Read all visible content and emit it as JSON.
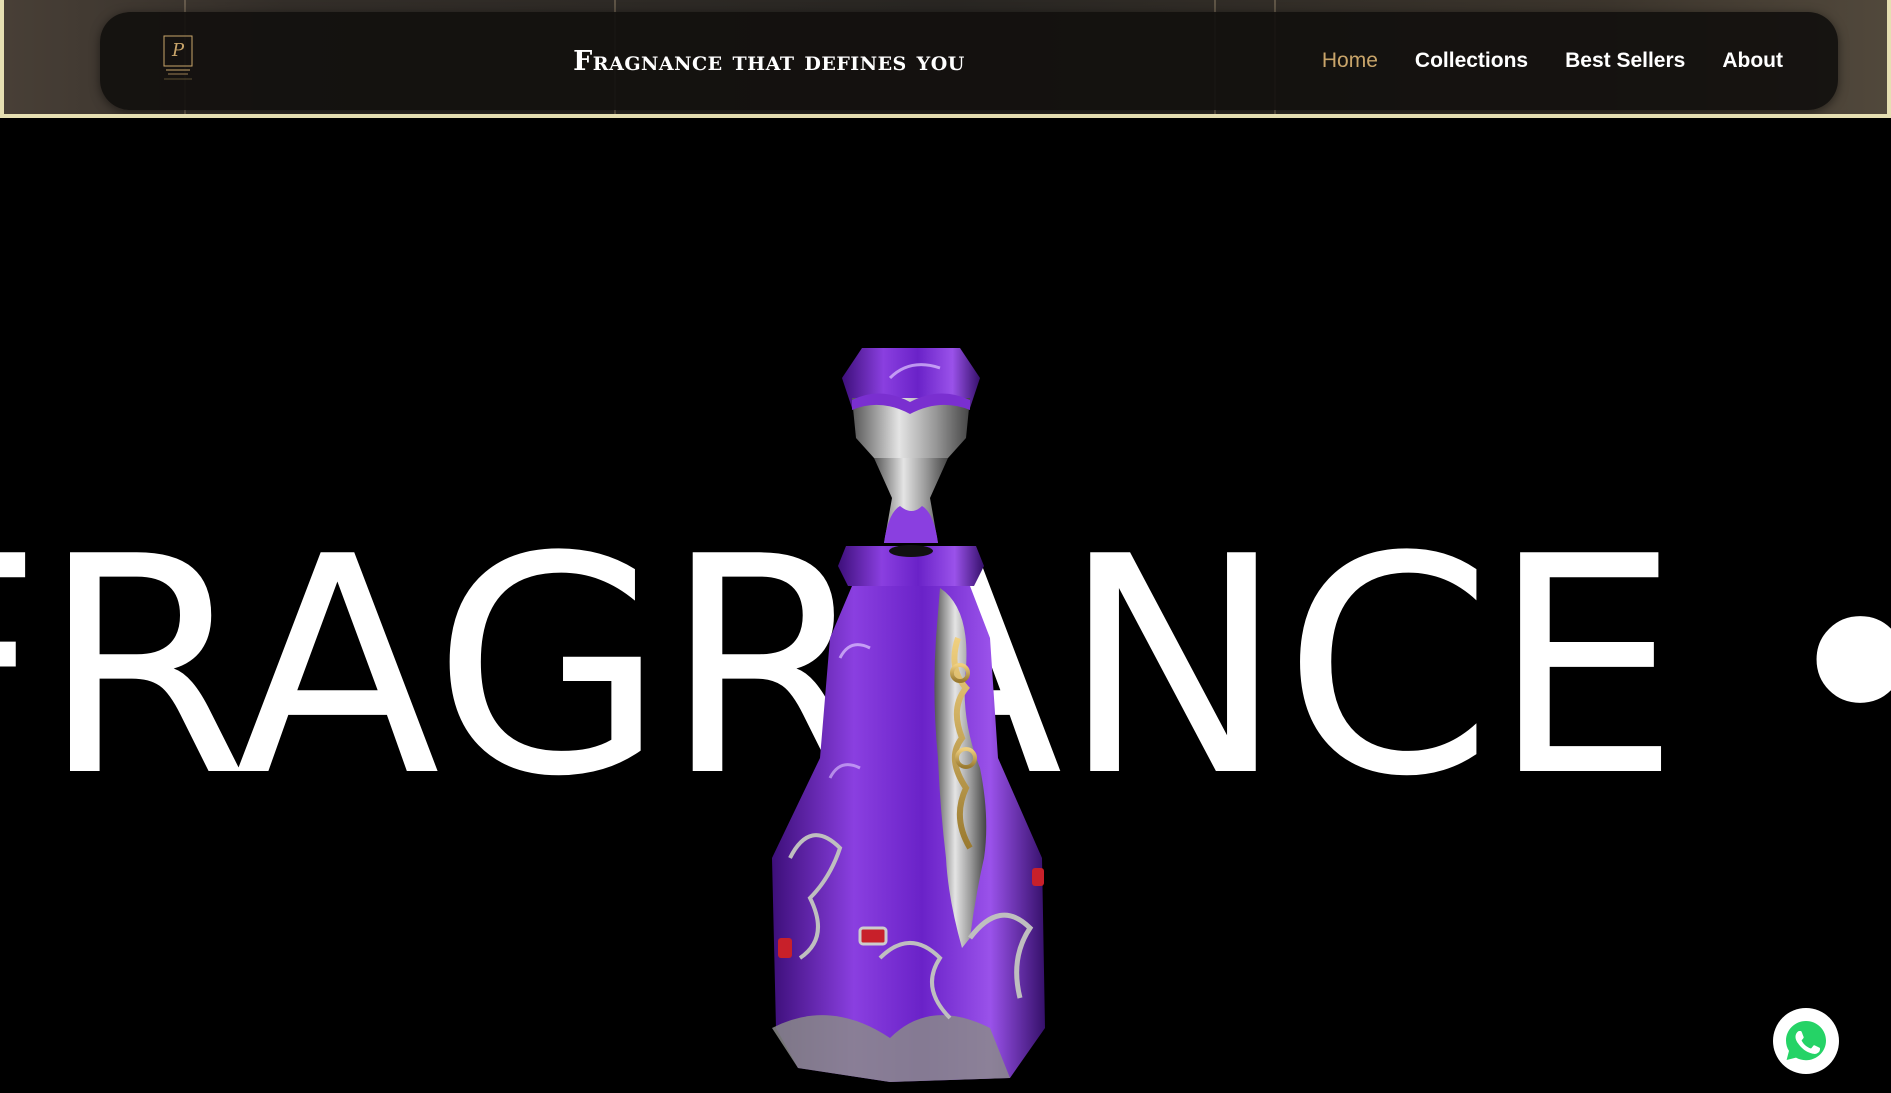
{
  "header": {
    "tagline": "Fragnance that defines you",
    "logo_icon": "perfume-brand-logo",
    "nav": [
      {
        "label": "Home",
        "active": true
      },
      {
        "label": "Collections",
        "active": false
      },
      {
        "label": "Best Sellers",
        "active": false
      },
      {
        "label": "About",
        "active": false
      }
    ]
  },
  "hero": {
    "marquee_text": "FRAGRANCE • LUXURY",
    "visual": "purple-perfume-bottle"
  },
  "floating": {
    "whatsapp_icon": "whatsapp-icon"
  },
  "colors": {
    "accent_gold": "#c9a56a",
    "header_border": "#e6dfb2",
    "bottle_purple": "#7b2fd6",
    "whatsapp_green": "#25d366"
  }
}
